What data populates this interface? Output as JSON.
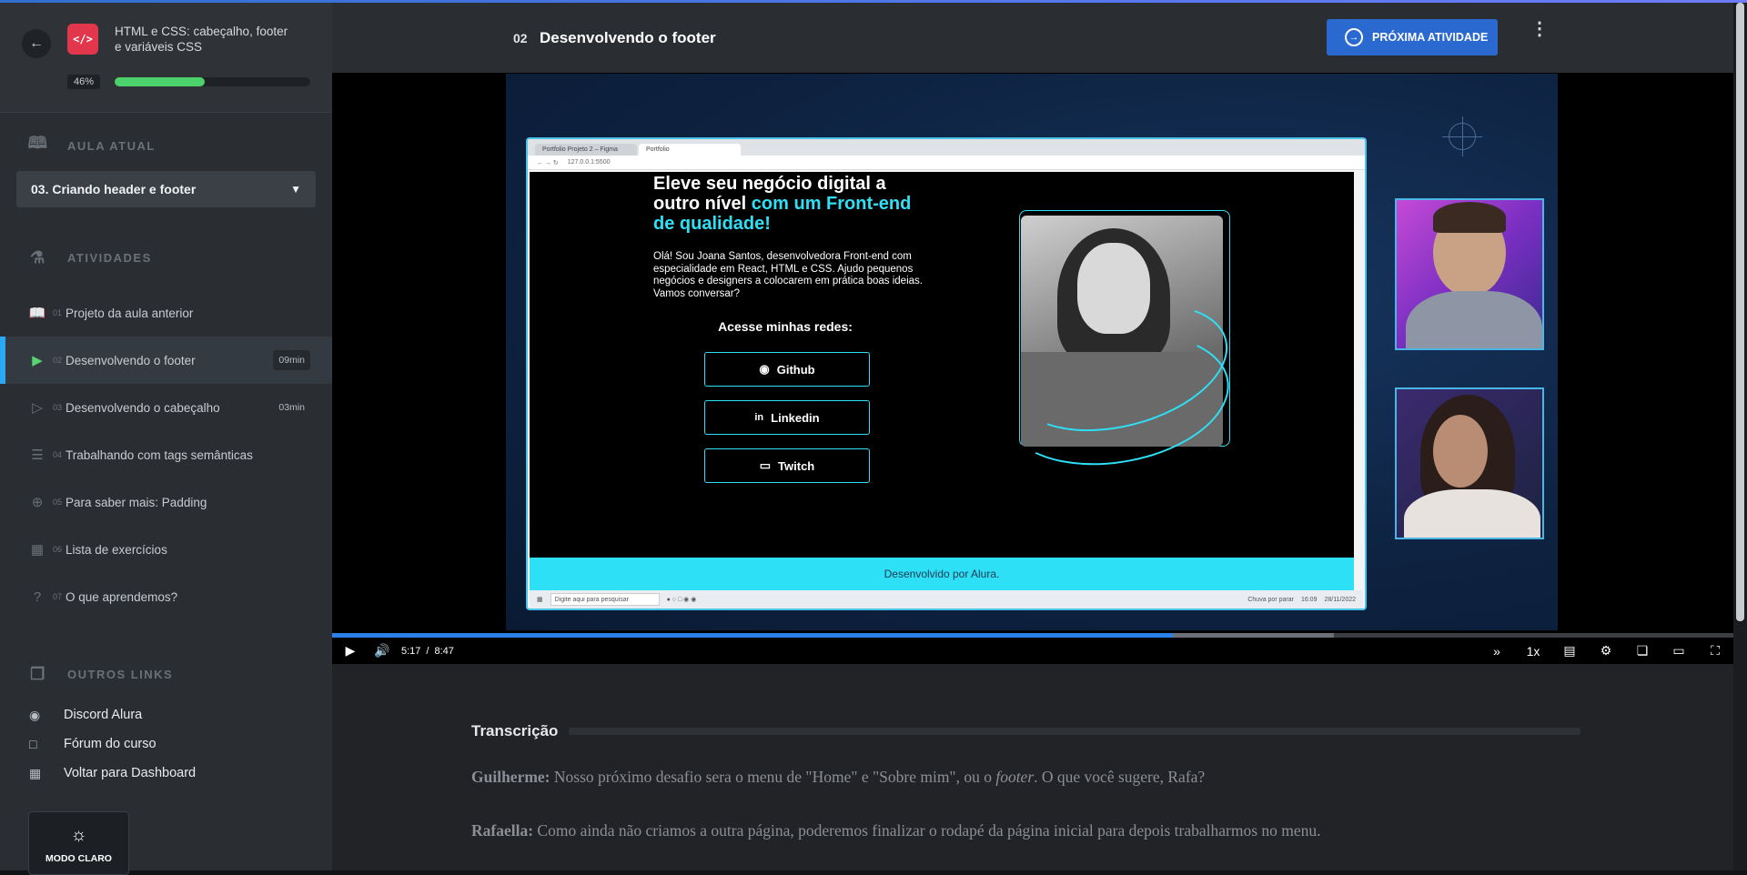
{
  "sidebar": {
    "course_title": "HTML e CSS: cabeçalho, footer e variáveis CSS",
    "progress_label": "46%",
    "progress_value": 0.46,
    "current_lesson_section": "AULA ATUAL",
    "current_lesson": "03. Criando header e footer",
    "activities_section": "ATIVIDADES",
    "activities": [
      {
        "num": "01",
        "label": "Projeto da aula anterior",
        "duration": "",
        "icon": "book-icon"
      },
      {
        "num": "02",
        "label": "Desenvolvendo o footer",
        "duration": "09min",
        "icon": "video-icon"
      },
      {
        "num": "03",
        "label": "Desenvolvendo o cabeçalho",
        "duration": "03min",
        "icon": "video-icon"
      },
      {
        "num": "04",
        "label": "Trabalhando com tags semânticas",
        "duration": "",
        "icon": "list-icon"
      },
      {
        "num": "05",
        "label": "Para saber mais: Padding",
        "duration": "",
        "icon": "plus-circle-icon"
      },
      {
        "num": "06",
        "label": "Lista de exercícios",
        "duration": "",
        "icon": "grid-icon"
      },
      {
        "num": "07",
        "label": "O que aprendemos?",
        "duration": "",
        "icon": "person-question-icon"
      }
    ],
    "other_links_section": "OUTROS LINKS",
    "links": [
      {
        "label": "Discord Alura",
        "icon": "discord-icon"
      },
      {
        "label": "Fórum do curso",
        "icon": "forum-icon"
      },
      {
        "label": "Voltar para Dashboard",
        "icon": "dashboard-icon"
      }
    ],
    "theme_button": "MODO CLARO"
  },
  "header": {
    "lesson_number": "02",
    "lesson_title": "Desenvolvendo o footer",
    "next_button": "PRÓXIMA ATIVIDADE"
  },
  "video": {
    "browser_tabs": [
      "Portfolio Projeto 2 – Figma",
      "Portfolio"
    ],
    "browser_url": "127.0.0.1:5500",
    "site_headline_1": "Eleve seu negócio digital a outro nível",
    "site_headline_2": "com um Front-end de qualidade!",
    "site_body": "Olá! Sou Joana Santos, desenvolvedora Front-end com especialidade em React, HTML e CSS. Ajudo pequenos negócios e designers a colocarem em prática boas ideias. Vamos conversar?",
    "site_sub": "Acesse minhas redes:",
    "social_buttons": [
      "Github",
      "Linkedin",
      "Twitch"
    ],
    "site_footer": "Desenvolvido por Alura.",
    "taskbar_search": "Digite aqui para pesquisar",
    "taskbar_weather": "Chuva por parar",
    "taskbar_time": "16:09",
    "taskbar_date": "28/11/2022",
    "current_time": "5:17",
    "separator": "/",
    "duration": "8:47",
    "played_fraction": 0.6,
    "buffered_fraction": 0.585,
    "speed": "1x"
  },
  "transcript": {
    "title": "Transcrição",
    "lines": [
      {
        "speaker": "Guilherme:",
        "text_before": " Nosso próximo desafio sera o menu de \"Home\" e \"Sobre mim\", ou o ",
        "emph": "footer",
        "text_after": ". O que você sugere, Rafa?"
      },
      {
        "speaker": "Rafaella:",
        "text_before": " Como ainda não criamos a outra página, poderemos finalizar o rodapé da página inicial para depois trabalharmos no menu.",
        "emph": "",
        "text_after": ""
      }
    ]
  },
  "colors": {
    "accent_blue": "#2a6ad0",
    "progress_green": "#4cd26b",
    "active_marker": "#2aa7f5",
    "cyan": "#2ee0f5"
  }
}
